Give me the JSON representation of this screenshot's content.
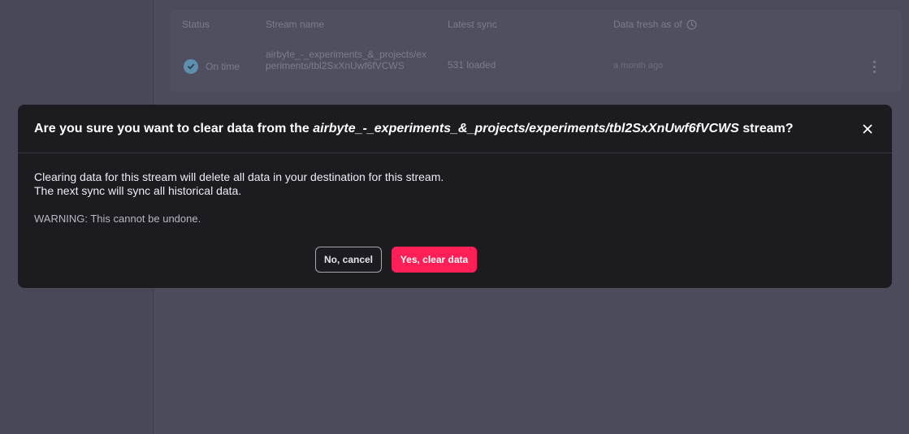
{
  "table": {
    "headers": {
      "status": "Status",
      "stream_name": "Stream name",
      "latest_sync": "Latest sync",
      "data_fresh": "Data fresh as of"
    },
    "row": {
      "status": "On time",
      "stream_name": "airbyte_-_experiments_&_projects/experiments/tbl2SxXnUwf6fVCWS",
      "latest_sync": "531 loaded",
      "data_fresh": "a month ago"
    }
  },
  "modal": {
    "title_prefix": "Are you sure you want to clear data from the ",
    "title_stream": "airbyte_-_experiments_&_projects/experiments/tbl2SxXnUwf6fVCWS",
    "title_suffix": " stream?",
    "body_line1": "Clearing data for this stream will delete all data in your destination for this stream.",
    "body_line2": "The next sync will sync all historical data.",
    "warning": "WARNING: This cannot be undone.",
    "cancel_label": "No, cancel",
    "confirm_label": "Yes, clear data"
  },
  "icons": {
    "status": "check-circle-icon",
    "fresh": "clock-icon",
    "row_menu": "kebab-menu-icon",
    "close": "close-icon"
  },
  "colors": {
    "backdrop": "#4a4a5a",
    "modal_bg": "#1b1b20",
    "danger": "#ff1f57",
    "status_ok": "#5f8fae"
  }
}
